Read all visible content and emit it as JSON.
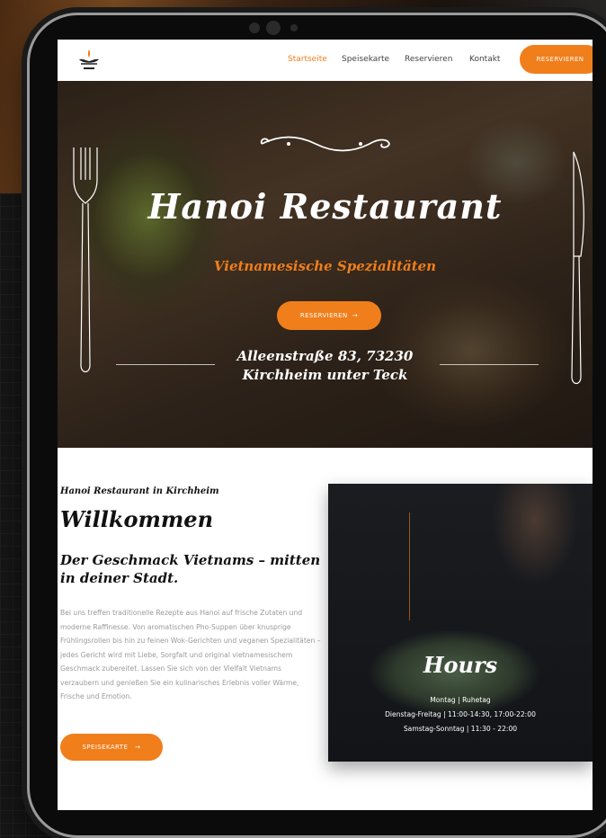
{
  "nav": {
    "links": [
      "Startseite",
      "Speisekarte",
      "Reservieren",
      "Kontakt"
    ],
    "cta": "RESERVIEREN"
  },
  "hero": {
    "title": "Hanoi Restaurant",
    "subtitle": "Vietnamesische Spezialitäten",
    "button": "RESERVIEREN",
    "address_line1": "Alleenstraße 83, 73230",
    "address_line2": "Kirchheim unter Teck"
  },
  "welcome": {
    "kicker": "Hanoi Restaurant in Kirchheim",
    "title": "Willkommen",
    "subtitle": "Der Geschmack Vietnams – mitten in deiner Stadt.",
    "body": "Bei uns treffen traditionelle Rezepte aus Hanoi auf frische Zutaten und moderne Raffinesse. Von aromatischen Pho-Suppen über knusprige Frühlingsrollen bis hin zu feinen Wok-Gerichten und veganen Spezialitäten – jedes Gericht wird mit Liebe, Sorgfalt und original vietnamesischem Geschmack zubereitet. Lassen Sie sich von der Vielfalt Vietnams verzaubern und genießen Sie ein kulinarisches Erlebnis voller Wärme, Frische und Emotion.",
    "button": "SPEISEKARTE"
  },
  "hours": {
    "title": "Hours",
    "lines": [
      "Montag | Ruhetag",
      "Dienstag-Freitag | 11:00-14:30, 17:00-22:00",
      "Samstag-Sonntag | 11:30 - 22:00"
    ]
  },
  "colors": {
    "accent": "#f07e1b",
    "text": "#111111",
    "muted": "#9a9a9a"
  },
  "icons": [
    "logo-icon",
    "arrow-right-icon",
    "ornament-icon",
    "fork-icon",
    "knife-icon"
  ]
}
